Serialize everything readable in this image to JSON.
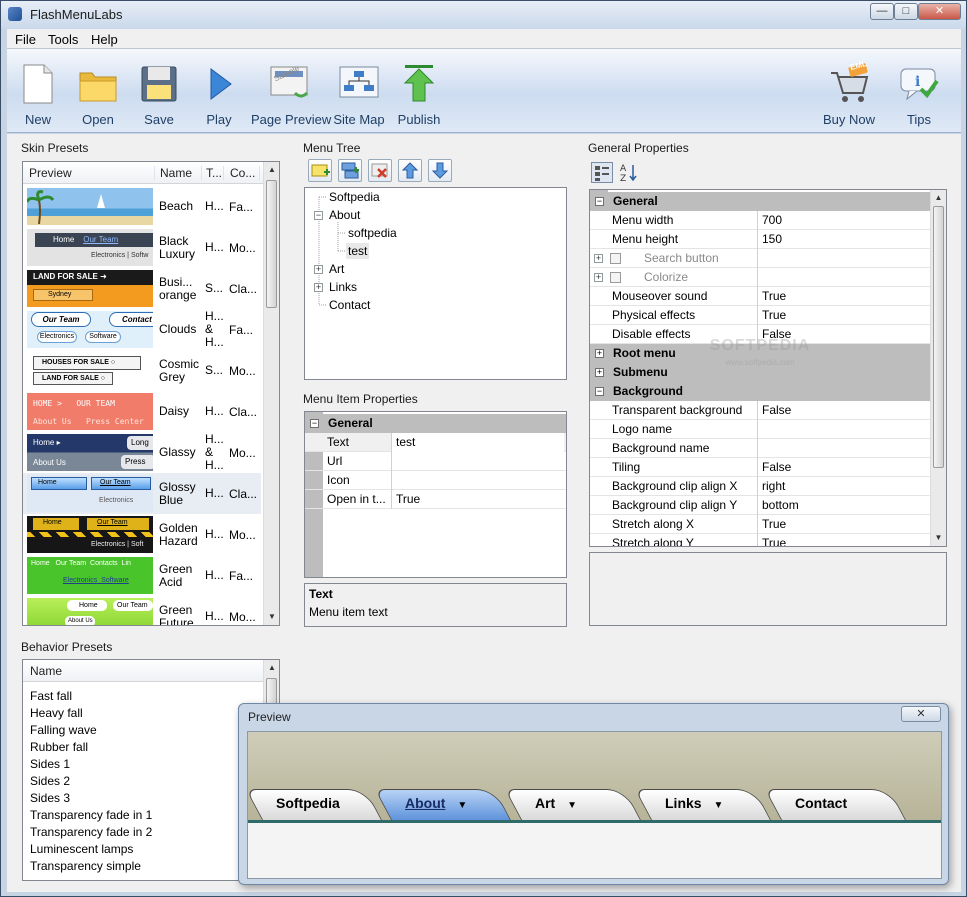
{
  "window": {
    "title": "FlashMenuLabs",
    "min": "—",
    "max": "□",
    "close": "✕"
  },
  "menubar": [
    "File",
    "Tools",
    "Help"
  ],
  "toolbar": {
    "buttons": [
      "New",
      "Open",
      "Save",
      "Play",
      "Page Preview",
      "Site Map",
      "Publish"
    ],
    "right_buttons": [
      "Buy Now",
      "Tips"
    ],
    "eml_badge": "EML",
    "sample_badge": "Sample"
  },
  "skin_presets": {
    "title": "Skin Presets",
    "columns": [
      "Preview",
      "Name",
      "T...",
      "Co..."
    ],
    "rows": [
      {
        "name": "Beach",
        "t": "H...",
        "co": "Fa..."
      },
      {
        "name": "Black Luxury",
        "t": "H...",
        "co": "Mo..."
      },
      {
        "name": "Busi... orange",
        "t": "S...",
        "co": "Cla..."
      },
      {
        "name": "Clouds",
        "t": "H... & H...",
        "co": "Fa..."
      },
      {
        "name": "Cosmic Grey",
        "t": "S...",
        "co": "Mo..."
      },
      {
        "name": "Daisy",
        "t": "H...",
        "co": "Cla..."
      },
      {
        "name": "Glassy",
        "t": "H... & H...",
        "co": "Mo..."
      },
      {
        "name": "Glossy Blue",
        "t": "H...",
        "co": "Cla..."
      },
      {
        "name": "Golden Hazard",
        "t": "H...",
        "co": "Mo..."
      },
      {
        "name": "Green Acid",
        "t": "H...",
        "co": "Fa..."
      },
      {
        "name": "Green Future",
        "t": "H...",
        "co": "Mo..."
      }
    ],
    "thumb_text": {
      "black_luxury": [
        "Home",
        "Our Team",
        "Electronics",
        "Softw"
      ],
      "business": [
        "LAND FOR SALE ➜",
        "Sydney"
      ],
      "clouds": [
        "Our Team",
        "Contact",
        "Electronics",
        "Software"
      ],
      "cosmic": [
        "HOUSES FOR SALE ○",
        "LAND FOR SALE ○"
      ],
      "daisy": [
        "HOME",
        "OUR TEAM",
        "About Us",
        "Press Center"
      ],
      "glassy": [
        "Home ▸",
        "Long",
        "About Us",
        "Press"
      ],
      "glossy": [
        "Home",
        "Our Team",
        "Electronics"
      ],
      "golden": [
        "Home",
        "Our Team",
        "Electronics",
        "Soft"
      ],
      "green_acid": [
        "Home",
        "Our Team",
        "Contacts",
        "Lin",
        "Electronics",
        "Software"
      ],
      "green_future": [
        "Home",
        "Our Team",
        "About Us"
      ]
    }
  },
  "behavior_presets": {
    "title": "Behavior Presets",
    "column": "Name",
    "items": [
      "Fast fall",
      "Heavy fall",
      "Falling wave",
      "Rubber fall",
      "Sides 1",
      "Sides 2",
      "Sides 3",
      "Transparency fade in 1",
      "Transparency fade in 2",
      "Luminescent lamps",
      "Transparency simple"
    ]
  },
  "menu_tree": {
    "title": "Menu Tree",
    "items": [
      {
        "label": "Softpedia",
        "depth": 0,
        "expander": ""
      },
      {
        "label": "About",
        "depth": 0,
        "expander": "−"
      },
      {
        "label": "softpedia",
        "depth": 1,
        "expander": ""
      },
      {
        "label": "test",
        "depth": 1,
        "expander": ""
      },
      {
        "label": "Art",
        "depth": 0,
        "expander": "+"
      },
      {
        "label": "Links",
        "depth": 0,
        "expander": "+"
      },
      {
        "label": "Contact",
        "depth": 0,
        "expander": ""
      }
    ]
  },
  "menu_item_properties": {
    "title": "Menu Item Properties",
    "category": "General",
    "rows": [
      {
        "key": "Text",
        "value": "test"
      },
      {
        "key": "Url",
        "value": ""
      },
      {
        "key": "Icon",
        "value": ""
      },
      {
        "key": "Open in t...",
        "value": "True"
      }
    ],
    "desc_title": "Text",
    "desc_text": "Menu item text"
  },
  "general_properties": {
    "title": "General Properties",
    "watermark": "SOFTPEDIA",
    "watermark_sub": "www.softpedia.com",
    "rows": [
      {
        "type": "cat",
        "label": "General",
        "exp": "−"
      },
      {
        "type": "row",
        "key": "Menu width",
        "value": "700"
      },
      {
        "type": "row",
        "key": "Menu height",
        "value": "150"
      },
      {
        "type": "sub",
        "key": "Search button",
        "value": ""
      },
      {
        "type": "sub",
        "key": "Colorize",
        "value": ""
      },
      {
        "type": "row",
        "key": "Mouseover sound",
        "value": "True"
      },
      {
        "type": "row",
        "key": "Physical effects",
        "value": "True"
      },
      {
        "type": "row",
        "key": "Disable effects",
        "value": "False"
      },
      {
        "type": "cat",
        "label": "Root menu",
        "exp": "+"
      },
      {
        "type": "cat",
        "label": "Submenu",
        "exp": "+"
      },
      {
        "type": "cat",
        "label": "Background",
        "exp": "−"
      },
      {
        "type": "row",
        "key": "Transparent background",
        "value": "False"
      },
      {
        "type": "row",
        "key": "Logo name",
        "value": ""
      },
      {
        "type": "row",
        "key": "Background name",
        "value": ""
      },
      {
        "type": "row",
        "key": "Tiling",
        "value": "False"
      },
      {
        "type": "row",
        "key": "Background clip align X",
        "value": "right"
      },
      {
        "type": "row",
        "key": "Background clip align Y",
        "value": "bottom"
      },
      {
        "type": "row",
        "key": "Stretch along X",
        "value": "True"
      },
      {
        "type": "row",
        "key": "Stretch along Y",
        "value": "True"
      }
    ]
  },
  "preview": {
    "title": "Preview",
    "close": "✕",
    "tabs": [
      {
        "label": "Softpedia",
        "arrow": ""
      },
      {
        "label": "About",
        "arrow": "▼"
      },
      {
        "label": "Art",
        "arrow": "▼"
      },
      {
        "label": "Links",
        "arrow": "▼"
      },
      {
        "label": "Contact",
        "arrow": ""
      }
    ]
  }
}
